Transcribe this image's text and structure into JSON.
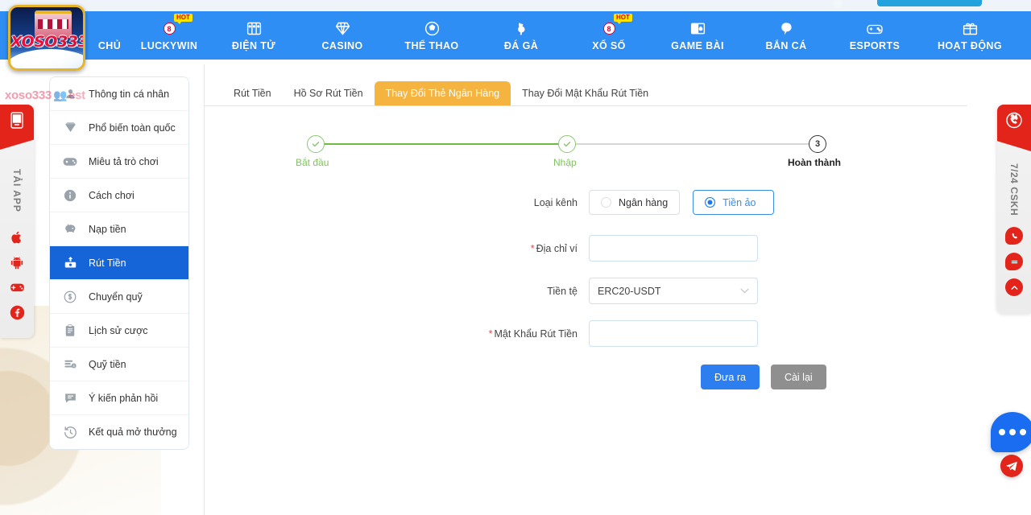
{
  "nav": {
    "items": [
      {
        "label": "CHỦ",
        "icon": "home-icon",
        "badge": null,
        "hot": false
      },
      {
        "label": "LUCKYWIN",
        "icon": "lucky8-icon",
        "badge": "8",
        "hot": true
      },
      {
        "label": "ĐIỆN TỬ",
        "icon": "slot-machine-icon",
        "badge": null,
        "hot": false
      },
      {
        "label": "CASINO",
        "icon": "diamond-icon",
        "badge": null,
        "hot": false
      },
      {
        "label": "THỂ THAO",
        "icon": "soccer-ball-icon",
        "badge": null,
        "hot": false
      },
      {
        "label": "ĐÁ GÀ",
        "icon": "rooster-icon",
        "badge": null,
        "hot": false
      },
      {
        "label": "XỔ SỐ",
        "icon": "lottery8-icon",
        "badge": "8",
        "hot": true
      },
      {
        "label": "GAME BÀI",
        "icon": "playing-cards-icon",
        "badge": null,
        "hot": false
      },
      {
        "label": "BẮN CÁ",
        "icon": "fish-icon",
        "badge": null,
        "hot": false
      },
      {
        "label": "ESPORTS",
        "icon": "gamepad-icon",
        "badge": null,
        "hot": false
      },
      {
        "label": "HOẠT ĐỘNG",
        "icon": "gift-icon",
        "badge": null,
        "hot": false
      }
    ],
    "hot_label": "HOT"
  },
  "logo": {
    "text": "XOSO",
    "accent": "333"
  },
  "watermark": {
    "brand": "xoso333",
    "suffix": "est"
  },
  "rail_left": {
    "vertical_label": "TẢI APP",
    "head_icon": "mobile-app-icon",
    "icons": [
      "apple-icon",
      "android-icon",
      "gamepad-icon",
      "facebook-icon"
    ]
  },
  "rail_right": {
    "vertical_label": "7/24 CSKH",
    "head_icon": "phone-24h-icon",
    "icons": [
      "phone-chat-icon",
      "message-icon",
      "scroll-top-icon"
    ]
  },
  "floating": {
    "chat_icon": "chat-dots-icon",
    "telegram_icon": "telegram-icon"
  },
  "sidebar": {
    "items": [
      {
        "label": "Thông tin cá nhân",
        "icon": "user-info-icon",
        "active": false
      },
      {
        "label": "Phổ biến toàn quốc",
        "icon": "diamond-icon",
        "active": false
      },
      {
        "label": "Miêu tả trò chơi",
        "icon": "gamepad-icon",
        "active": false
      },
      {
        "label": "Cách chơi",
        "icon": "info-icon",
        "active": false
      },
      {
        "label": "Nạp tiền",
        "icon": "piggy-bank-icon",
        "active": false
      },
      {
        "label": "Rút Tiền",
        "icon": "withdraw-icon",
        "active": true
      },
      {
        "label": "Chuyển quỹ",
        "icon": "dollar-circle-icon",
        "active": false
      },
      {
        "label": "Lịch sử cược",
        "icon": "clipboard-icon",
        "active": false
      },
      {
        "label": "Quỹ tiền",
        "icon": "coins-icon",
        "active": false
      },
      {
        "label": "Ý kiến phản hồi",
        "icon": "speech-bubble-icon",
        "active": false
      },
      {
        "label": "Kết quả mở thưởng",
        "icon": "history-clock-icon",
        "active": false
      }
    ]
  },
  "main": {
    "tabs": [
      {
        "label": "Rút Tiền",
        "active": false
      },
      {
        "label": "Hồ Sơ Rút Tiền",
        "active": false
      },
      {
        "label": "Thay Đổi Thẻ Ngân Hàng",
        "active": true
      },
      {
        "label": "Thay Đổi Mật Khẩu Rút Tiền",
        "active": false
      }
    ],
    "stepper": {
      "steps": [
        {
          "label": "Bắt đầu",
          "state": "done",
          "marker": "check"
        },
        {
          "label": "Nhập",
          "state": "done",
          "marker": "check"
        },
        {
          "label": "Hoàn thành",
          "state": "current",
          "marker": "3"
        }
      ]
    },
    "form": {
      "channel": {
        "label": "Loại kênh",
        "options": [
          {
            "label": "Ngân hàng",
            "selected": false
          },
          {
            "label": "Tiền ảo",
            "selected": true
          }
        ]
      },
      "wallet_address": {
        "label": "Địa chỉ ví",
        "required": true,
        "value": "",
        "placeholder": ""
      },
      "currency": {
        "label": "Tiền tệ",
        "required": false,
        "value": "ERC20-USDT",
        "chevron": "chevron-down-icon"
      },
      "withdraw_password": {
        "label": "Mật Khẩu Rút Tiền",
        "required": true,
        "value": "",
        "placeholder": ""
      },
      "submit_label": "Đưa ra",
      "reset_label": "Cài lại"
    }
  },
  "colors": {
    "nav_blue": "#2f8ef4",
    "tab_orange": "#f5b340",
    "menu_active_blue": "#1565d8",
    "primary_blue": "#2d7ff0",
    "reset_gray": "#8f8f8f",
    "step_green": "#70b944",
    "rail_red": "#e2241b"
  }
}
